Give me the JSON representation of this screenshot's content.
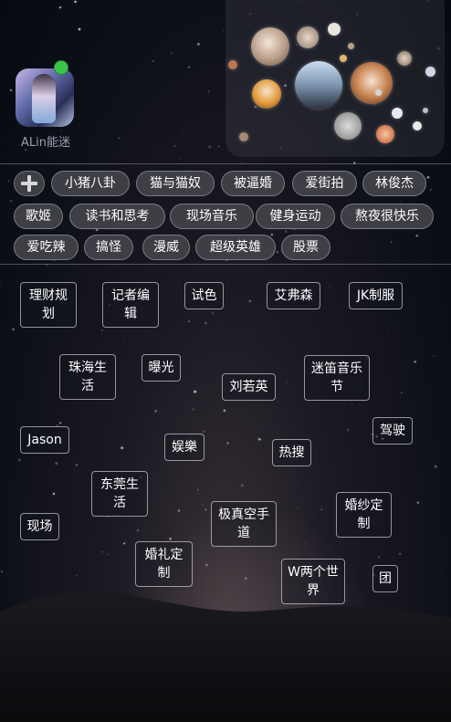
{
  "profile": {
    "username": "ALin能迷",
    "online": true
  },
  "followed_avatars": [
    {
      "name": "avatar-bubble-1"
    },
    {
      "name": "avatar-bubble-2"
    },
    {
      "name": "avatar-bubble-3"
    },
    {
      "name": "avatar-bubble-4"
    },
    {
      "name": "avatar-bubble-5"
    },
    {
      "name": "avatar-bubble-6"
    },
    {
      "name": "avatar-bubble-7"
    },
    {
      "name": "avatar-bubble-8"
    }
  ],
  "category_chips": [
    "小猪八卦",
    "猫与猫奴",
    "被逼婚",
    "爱街拍",
    "林俊杰",
    "歌姬",
    "读书和思考",
    "现场音乐",
    "健身运动",
    "熬夜很快乐",
    "爱吃辣",
    "搞怪",
    "漫威",
    "超级英雄",
    "股票"
  ],
  "floating_tags": [
    "理财规划",
    "记者编辑",
    "试色",
    "艾弗森",
    "JK制服",
    "珠海生活",
    "曝光",
    "刘若英",
    "迷笛音乐节",
    "Jason",
    "娱樂",
    "热搜",
    "驾驶",
    "东莞生活",
    "现场",
    "极真空手道",
    "婚纱定制",
    "婚礼定制",
    "W两个世界",
    "团"
  ],
  "icons": {
    "add": "plus-icon"
  },
  "colors": {
    "online": "#3bc34a",
    "chip_bg": "#3d3f45"
  }
}
